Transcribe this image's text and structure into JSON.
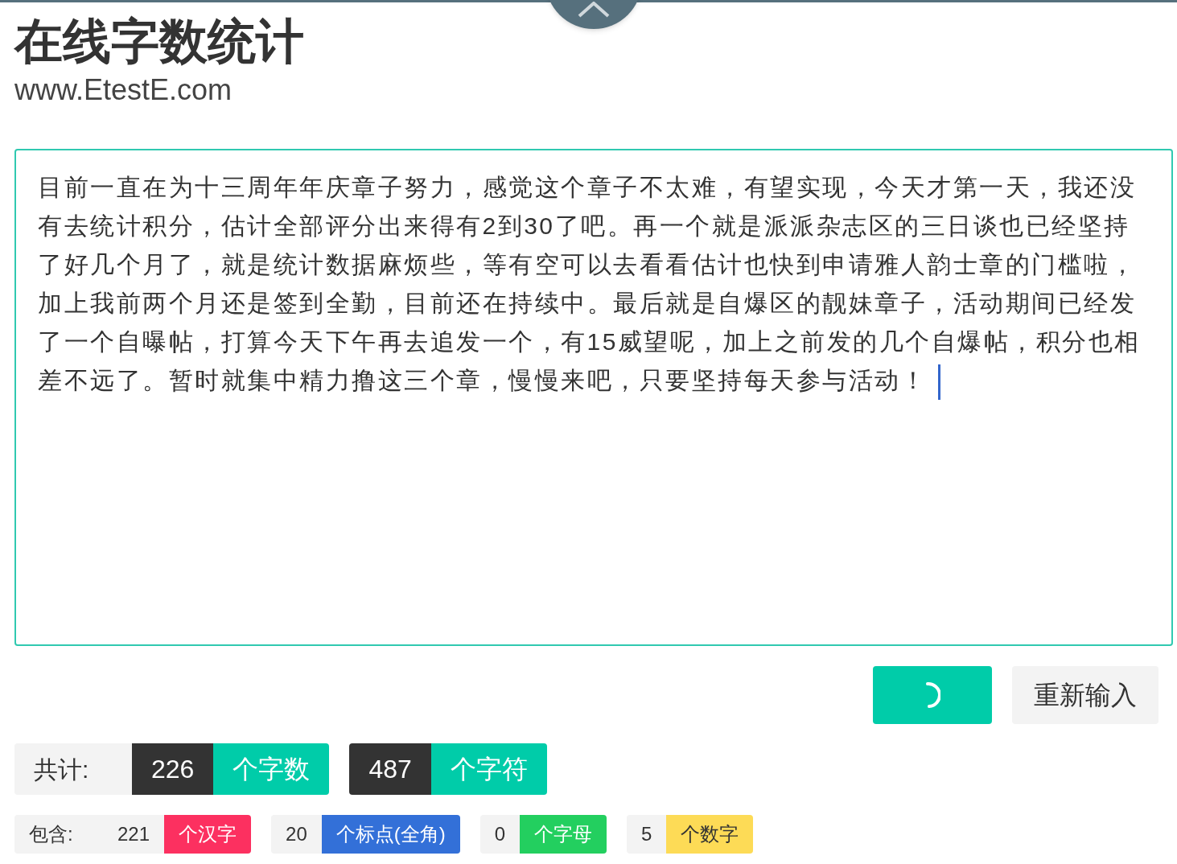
{
  "header": {
    "title": "在线字数统计",
    "url": "www.EtestE.com"
  },
  "editor": {
    "value": "目前一直在为十三周年年庆章子努力，感觉这个章子不太难，有望实现，今天才第一天，我还没有去统计积分，估计全部评分出来得有2到30了吧。再一个就是派派杂志区的三日谈也已经坚持了好几个月了，就是统计数据麻烦些，等有空可以去看看估计也快到申请雅人韵士章的门槛啦，加上我前两个月还是签到全勤，目前还在持续中。最后就是自爆区的靓妹章子，活动期间已经发了一个自曝帖，打算今天下午再去追发一个，有15威望呢，加上之前发的几个自爆帖，积分也相差不远了。暂时就集中精力撸这三个章，慢慢来吧，只要坚持每天参与活动！",
    "focused": true
  },
  "actions": {
    "count_button": {
      "loading": true
    },
    "reset_button": {
      "label": "重新输入"
    }
  },
  "totals": {
    "label": "共计:",
    "items": [
      {
        "value": "226",
        "unit": "个字数"
      },
      {
        "value": "487",
        "unit": "个字符"
      }
    ]
  },
  "breakdown": {
    "label": "包含:",
    "items": [
      {
        "value": "221",
        "unit": "个汉字",
        "color": "#fc3060"
      },
      {
        "value": "20",
        "unit": "个标点(全角)",
        "color": "#3370d8"
      },
      {
        "value": "0",
        "unit": "个字母",
        "color": "#23cf5f"
      },
      {
        "value": "5",
        "unit": "个数字",
        "color": "#fddb56"
      }
    ]
  }
}
